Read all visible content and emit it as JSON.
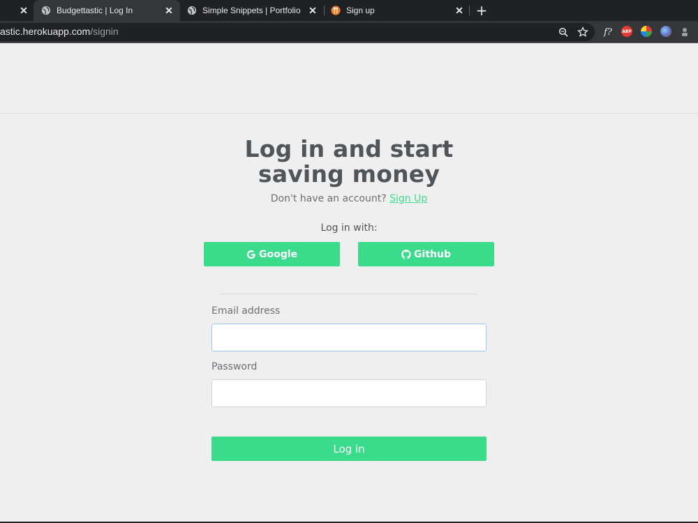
{
  "browser": {
    "tabs": [
      {
        "title": ""
      },
      {
        "title": "Budgettastic | Log In"
      },
      {
        "title": "Simple Snippets | Portfolio"
      },
      {
        "title": "Sign up"
      }
    ],
    "url": {
      "host": "astic.herokuapp.com",
      "path": "/signin"
    },
    "icons": {
      "zoom": "zoom-icon",
      "bookmark": "star-icon",
      "new_tab": "plus-icon",
      "extensions": [
        "font-ext-icon",
        "adblock-icon",
        "color-ext-icon",
        "globe-ext-icon",
        "profile-ext-icon"
      ]
    },
    "ext_labels": {
      "font": "f?",
      "abp": "ABP"
    }
  },
  "page": {
    "heading_line1": "Log in and start",
    "heading_line2": "saving money",
    "no_account_text": "Don't have an account?",
    "signup_link": "Sign Up",
    "login_with": "Log in with:",
    "google_label": "Google",
    "github_label": "Github",
    "email_label": "Email address",
    "email_value": "",
    "password_label": "Password",
    "password_value": "",
    "login_button": "Log in"
  },
  "colors": {
    "accent": "#3bdb8c",
    "heading": "#4f5559",
    "background": "#efefef"
  }
}
